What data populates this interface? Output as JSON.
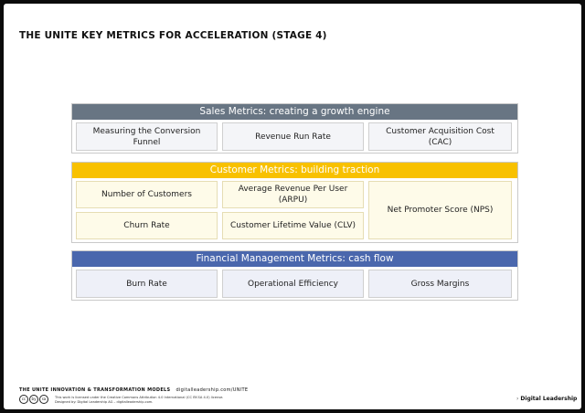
{
  "title": "THE UNITE KEY METRICS FOR ACCELERATION (STAGE 4)",
  "sales": {
    "header": "Sales Metrics: creating a growth engine",
    "items": [
      "Measuring the Conversion Funnel",
      "Revenue Run Rate",
      "Customer Acquisition Cost (CAC)"
    ]
  },
  "customer": {
    "header": "Customer Metrics: building traction",
    "items": [
      "Number of Customers",
      "Average Revenue Per User (ARPU)",
      "Net Promoter Score (NPS)",
      "Churn Rate",
      "Customer Lifetime Value (CLV)"
    ]
  },
  "financial": {
    "header": "Financial Management Metrics: cash flow",
    "items": [
      "Burn Rate",
      "Operational Efficiency",
      "Gross Margins"
    ]
  },
  "footer": {
    "models": "THE UNITE INNOVATION & TRANSFORMATION MODELS",
    "url": "digitalleadership.com/UNITE",
    "license_line1": "This work is licensed under the Creative Commons Attribution 4.0 International (CC BY-SA 4.0) license.",
    "license_line2": "Designed by: Digital Leadership AG – digitalleadership.com.",
    "cc_icons": [
      "cc",
      "by",
      "sa"
    ],
    "brand": "Digital Leadership"
  },
  "colors": {
    "sales_header": "#687583",
    "customer_header": "#f8c100",
    "financial_header": "#4a67ad"
  }
}
